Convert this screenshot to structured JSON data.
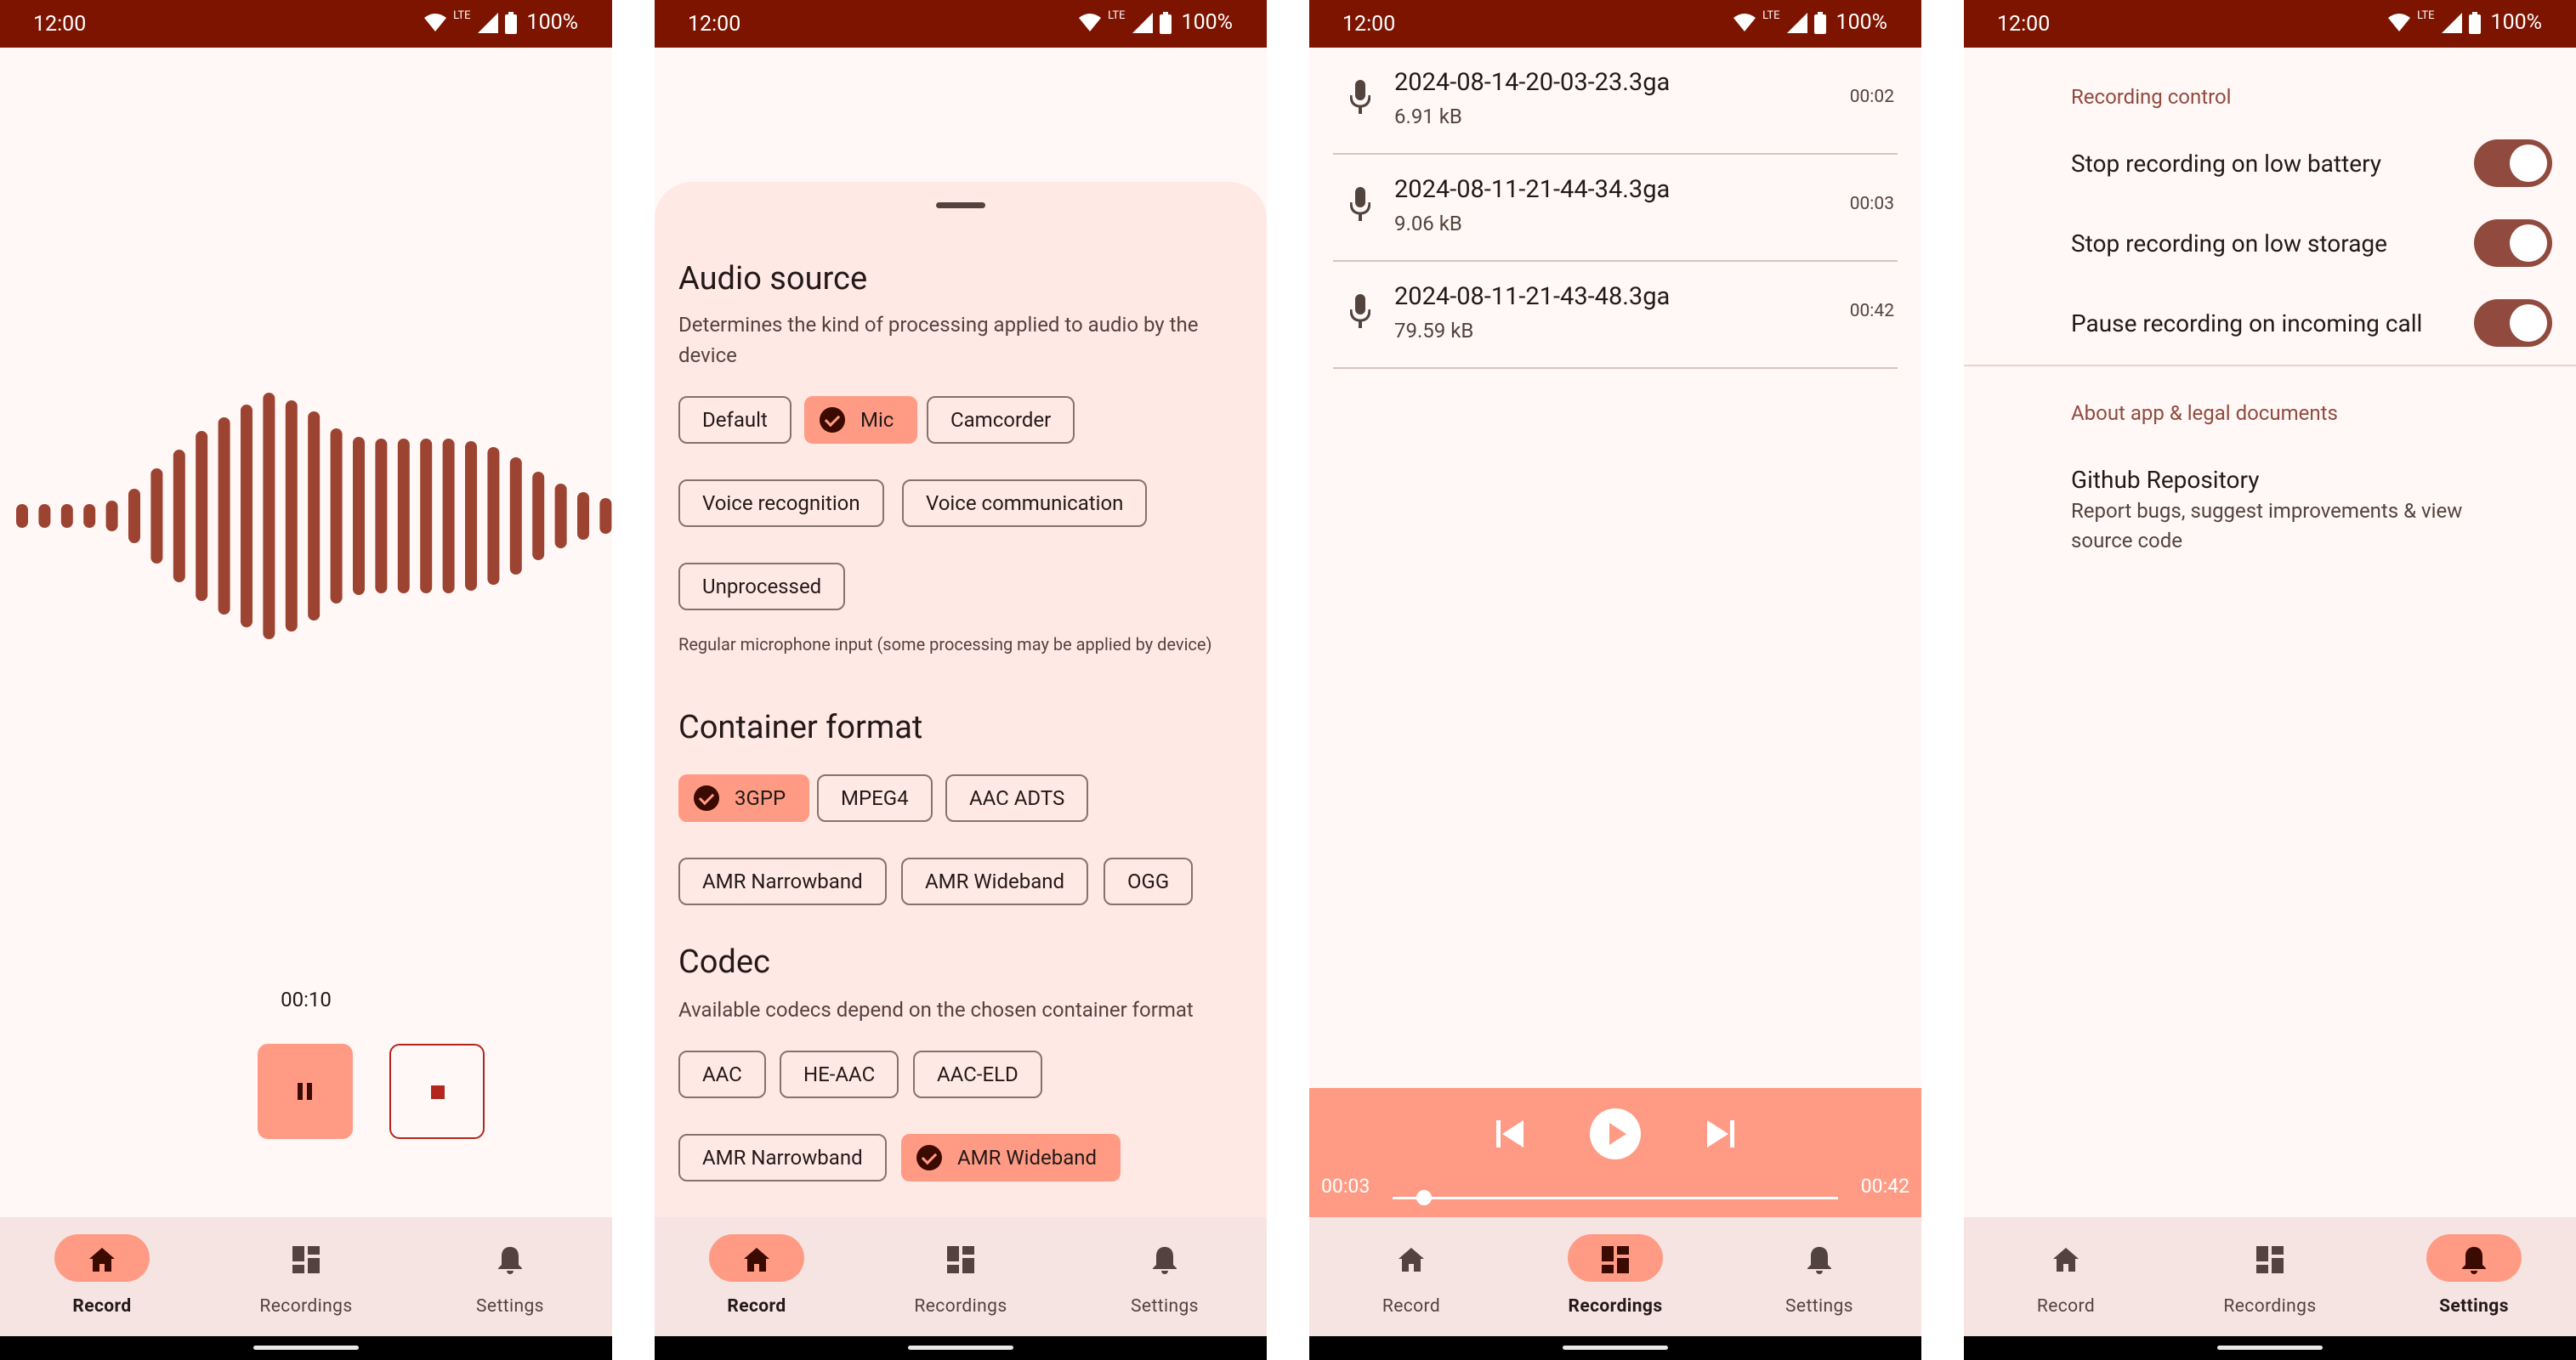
{
  "status": {
    "time": "12:00",
    "network": "LTE",
    "battery": "100%"
  },
  "nav": {
    "record": "Record",
    "recordings": "Recordings",
    "settings": "Settings"
  },
  "record_screen": {
    "elapsed": "00:10"
  },
  "options_sheet": {
    "audio_source": {
      "title": "Audio source",
      "description": "Determines the kind of processing applied to audio by the device",
      "options": [
        "Default",
        "Mic",
        "Camcorder",
        "Voice recognition",
        "Voice communication",
        "Unprocessed"
      ],
      "selected": "Mic",
      "selected_hint": "Regular microphone input (some processing may be applied by device)"
    },
    "container_format": {
      "title": "Container format",
      "options": [
        "3GPP",
        "MPEG4",
        "AAC ADTS",
        "AMR Narrowband",
        "AMR Wideband",
        "OGG"
      ],
      "selected": "3GPP"
    },
    "codec": {
      "title": "Codec",
      "description": "Available codecs depend on the chosen container format",
      "options": [
        "AAC",
        "HE-AAC",
        "AAC-ELD",
        "AMR Narrowband",
        "AMR Wideband"
      ],
      "selected": "AMR Wideband"
    }
  },
  "recordings": {
    "items": [
      {
        "name": "2024-08-14-20-03-23.3ga",
        "size": "6.91 kB",
        "duration": "00:02"
      },
      {
        "name": "2024-08-11-21-44-34.3ga",
        "size": "9.06 kB",
        "duration": "00:03"
      },
      {
        "name": "2024-08-11-21-43-48.3ga",
        "size": "79.59 kB",
        "duration": "00:42"
      }
    ],
    "player": {
      "current": "00:03",
      "total": "00:42",
      "progress": 0.07
    }
  },
  "settings": {
    "recording_control": {
      "header": "Recording control",
      "items": [
        {
          "label": "Stop recording on low battery",
          "enabled": true
        },
        {
          "label": "Stop recording on low storage",
          "enabled": true
        },
        {
          "label": "Pause recording on incoming call",
          "enabled": true
        }
      ]
    },
    "about": {
      "header": "About app & legal documents",
      "github_title": "Github Repository",
      "github_desc": "Report bugs, suggest improvements & view source code"
    }
  },
  "colors": {
    "statusbar": "#7d1400",
    "accent": "#ff9b85",
    "wave": "#9c4332",
    "toggle": "#904a3e",
    "background": "#fff8f6",
    "navbar": "#f5e4e1"
  },
  "icons": [
    "wifi-icon",
    "signal-icon",
    "battery-icon",
    "home-icon",
    "dashboard-icon",
    "bell-icon",
    "mic-icon",
    "pause-icon",
    "stop-icon",
    "play-icon",
    "skip-previous-icon",
    "skip-next-icon",
    "check-icon"
  ]
}
